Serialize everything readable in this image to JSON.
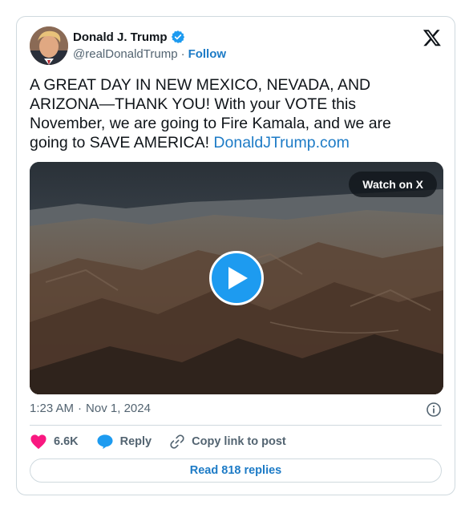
{
  "author": {
    "name": "Donald J. Trump",
    "handle": "@realDonaldTrump",
    "separator": "·",
    "follow_label": "Follow"
  },
  "tweet": {
    "text": "A GREAT DAY IN NEW MEXICO, NEVADA, AND ARIZONA—THANK YOU! With your VOTE this November, we are going to Fire Kamala, and we are going to SAVE AMERICA! ",
    "link_text": "DonaldJTrump.com"
  },
  "media": {
    "watch_label": "Watch on X",
    "type": "video"
  },
  "meta": {
    "time": "1:23 AM",
    "separator": "·",
    "date": "Nov 1, 2024"
  },
  "actions": {
    "likes": "6.6K",
    "reply_label": "Reply",
    "copy_link_label": "Copy link to post"
  },
  "replies_button": "Read 818 replies",
  "colors": {
    "accent": "#1d9bf0",
    "link": "#1d7bc6",
    "like": "#f91880",
    "border": "#cfd9de",
    "muted": "#536471"
  },
  "icons": [
    "verified-badge-icon",
    "x-logo-icon",
    "play-icon",
    "info-icon",
    "heart-icon",
    "reply-bubble-icon",
    "link-icon"
  ]
}
